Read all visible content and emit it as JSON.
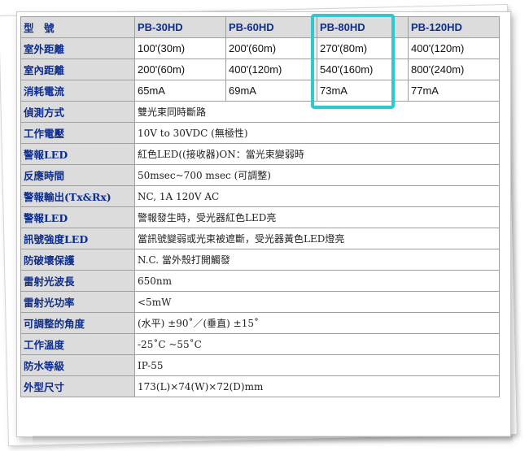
{
  "header": {
    "label": "型　號",
    "models": [
      "PB-30HD",
      "PB-60HD",
      "PB-80HD",
      "PB-120HD"
    ]
  },
  "model_rows": [
    {
      "label": "室外距離",
      "values": [
        "100'(30m)",
        "200'(60m)",
        "270'(80m)",
        "400'(120m)"
      ]
    },
    {
      "label": "室內距離",
      "values": [
        "200'(60m)",
        "400'(120m)",
        "540'(160m)",
        "800'(240m)"
      ]
    },
    {
      "label": "消耗電流",
      "values": [
        "65mA",
        "69mA",
        "73mA",
        "77mA"
      ]
    }
  ],
  "common_rows": [
    {
      "label": "偵測方式",
      "value": "雙光束同時斷路"
    },
    {
      "label": "工作電壓",
      "value": "10V to 30VDC (無極性)"
    },
    {
      "label": "警報LED",
      "value": "紅色LED((接收器)ON：當光束變弱時"
    },
    {
      "label": "反應時間",
      "value": "50msec~700 msec (可調整)"
    },
    {
      "label": "警報輸出(Tx&Rx)",
      "value": "NC, 1A 120V AC"
    },
    {
      "label": "警報LED",
      "value": "警報發生時，受光器紅色LED亮"
    },
    {
      "label": "訊號強度LED",
      "value": "當訊號變弱或光束被遮斷，受光器黃色LED燈亮"
    },
    {
      "label": "防破壞保護",
      "value": "N.C. 當外殼打開觸發"
    },
    {
      "label": "雷射光波長",
      "value": "650nm"
    },
    {
      "label": "雷射光功率",
      "value": "<5mW"
    },
    {
      "label": "可調整的角度",
      "value": "(水平) ±90˚／(垂直) ±15˚"
    },
    {
      "label": "工作溫度",
      "value": "-25˚C ~55˚C"
    },
    {
      "label": "防水等級",
      "value": "IP-55"
    },
    {
      "label": "外型尺寸",
      "value": "173(L)×74(W)×72(D)mm"
    }
  ],
  "colors": {
    "label_text": "#0d2d8f",
    "label_bg": "#dcdcdc",
    "highlight": "#2ec9cc"
  }
}
